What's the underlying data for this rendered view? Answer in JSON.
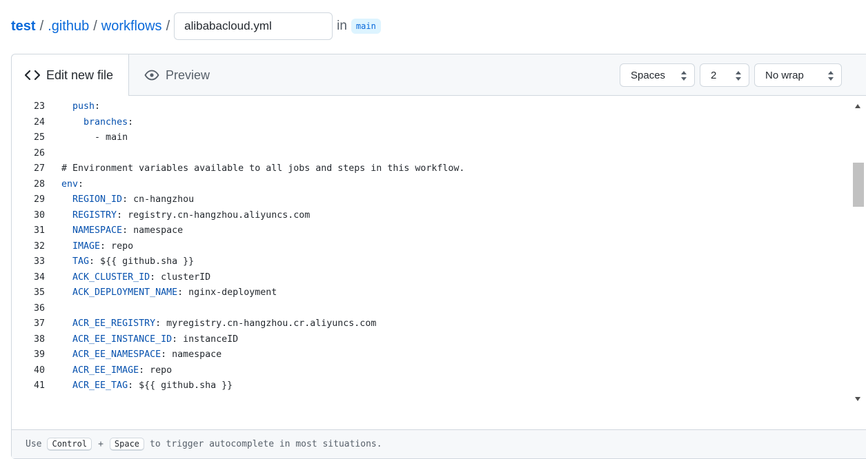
{
  "breadcrumb": {
    "repo": "test",
    "sep": "/",
    "folder1": ".github",
    "folder2": "workflows",
    "filename": "alibabacloud.yml",
    "in_label": "in",
    "branch": "main"
  },
  "tabs": {
    "edit": "Edit new file",
    "preview": "Preview"
  },
  "options": {
    "indent_mode": "Spaces",
    "indent_size": "2",
    "wrap_mode": "No wrap"
  },
  "code_lines": [
    {
      "n": "23",
      "indent": "  ",
      "key": "push",
      "rest": ":"
    },
    {
      "n": "24",
      "indent": "    ",
      "key": "branches",
      "rest": ":"
    },
    {
      "n": "25",
      "indent": "      ",
      "key": "",
      "rest": "- main"
    },
    {
      "n": "26",
      "indent": "",
      "key": "",
      "rest": ""
    },
    {
      "n": "27",
      "indent": "",
      "key": "",
      "rest": "# Environment variables available to all jobs and steps in this workflow."
    },
    {
      "n": "28",
      "indent": "",
      "key": "env",
      "rest": ":"
    },
    {
      "n": "29",
      "indent": "  ",
      "key": "REGION_ID",
      "rest": ": cn-hangzhou"
    },
    {
      "n": "30",
      "indent": "  ",
      "key": "REGISTRY",
      "rest": ": registry.cn-hangzhou.aliyuncs.com"
    },
    {
      "n": "31",
      "indent": "  ",
      "key": "NAMESPACE",
      "rest": ": namespace"
    },
    {
      "n": "32",
      "indent": "  ",
      "key": "IMAGE",
      "rest": ": repo"
    },
    {
      "n": "33",
      "indent": "  ",
      "key": "TAG",
      "rest": ": ${{ github.sha }}"
    },
    {
      "n": "34",
      "indent": "  ",
      "key": "ACK_CLUSTER_ID",
      "rest": ": clusterID"
    },
    {
      "n": "35",
      "indent": "  ",
      "key": "ACK_DEPLOYMENT_NAME",
      "rest": ": nginx-deployment"
    },
    {
      "n": "36",
      "indent": "",
      "key": "",
      "rest": ""
    },
    {
      "n": "37",
      "indent": "  ",
      "key": "ACR_EE_REGISTRY",
      "rest": ": myregistry.cn-hangzhou.cr.aliyuncs.com"
    },
    {
      "n": "38",
      "indent": "  ",
      "key": "ACR_EE_INSTANCE_ID",
      "rest": ": instanceID"
    },
    {
      "n": "39",
      "indent": "  ",
      "key": "ACR_EE_NAMESPACE",
      "rest": ": namespace"
    },
    {
      "n": "40",
      "indent": "  ",
      "key": "ACR_EE_IMAGE",
      "rest": ": repo"
    },
    {
      "n": "41",
      "indent": "  ",
      "key": "ACR_EE_TAG",
      "rest": ": ${{ github.sha }}"
    }
  ],
  "footer": {
    "use": "Use",
    "key1": "Control",
    "plus": "+",
    "key2": "Space",
    "tail": "to trigger autocomplete in most situations."
  },
  "colors": {
    "link": "#0969da",
    "key": "#0550ae",
    "border": "#d0d7de",
    "subtle_bg": "#f6f8fa"
  },
  "icons": {
    "edit_tab": "code-icon",
    "preview_tab": "eye-icon",
    "select": "select-arrows-icon"
  }
}
